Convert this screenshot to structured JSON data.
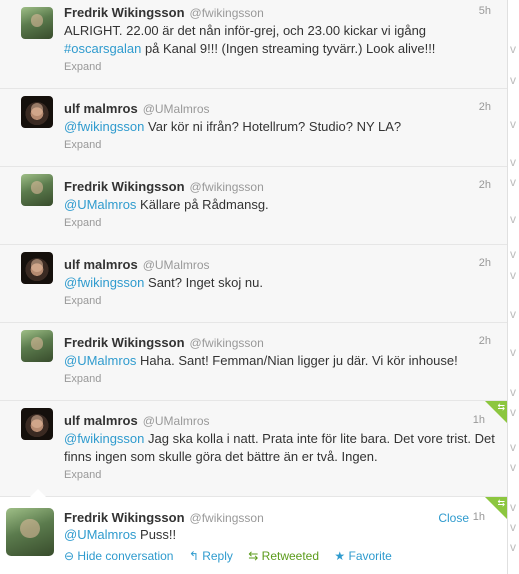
{
  "tweets": [
    {
      "name": "Fredrik Wikingsson",
      "handle": "@fwikingsson",
      "time": "5h",
      "text_parts": [
        {
          "t": "ALRIGHT. 22.00 är det nån inför-grej, och 23.00 kickar vi igång "
        },
        {
          "t": "#oscarsgalan",
          "link": true
        },
        {
          "t": " på Kanal 9!!! (Ingen streaming tyvärr.) Look alive!!!"
        }
      ],
      "expand": "Expand",
      "avatar": "fredrik-avatar"
    },
    {
      "name": "ulf malmros",
      "handle": "@UMalmros",
      "time": "2h",
      "text_parts": [
        {
          "t": "@fwikingsson",
          "link": true
        },
        {
          "t": " Var kör ni ifrån? Hotellrum? Studio? NY LA?"
        }
      ],
      "expand": "Expand",
      "avatar": "ulf-avatar"
    },
    {
      "name": "Fredrik Wikingsson",
      "handle": "@fwikingsson",
      "time": "2h",
      "text_parts": [
        {
          "t": "@UMalmros",
          "link": true
        },
        {
          "t": " Källare på Rådmansg."
        }
      ],
      "expand": "Expand",
      "avatar": "fredrik-avatar"
    },
    {
      "name": "ulf malmros",
      "handle": "@UMalmros",
      "time": "2h",
      "text_parts": [
        {
          "t": "@fwikingsson",
          "link": true
        },
        {
          "t": " Sant? Inget skoj nu."
        }
      ],
      "expand": "Expand",
      "avatar": "ulf-avatar"
    },
    {
      "name": "Fredrik Wikingsson",
      "handle": "@fwikingsson",
      "time": "2h",
      "text_parts": [
        {
          "t": "@UMalmros",
          "link": true
        },
        {
          "t": " Haha. Sant! Femman/Nian ligger ju där. Vi kör inhouse!"
        }
      ],
      "expand": "Expand",
      "avatar": "fredrik-avatar"
    },
    {
      "name": "ulf malmros",
      "handle": "@UMalmros",
      "time": "1h",
      "text_parts": [
        {
          "t": "@fwikingsson",
          "link": true
        },
        {
          "t": " Jag ska kolla i natt. Prata inte för lite bara. Det vore trist. Det finns ingen som skulle göra det bättre än er två. Ingen."
        }
      ],
      "expand": "Expand",
      "avatar": "ulf-avatar",
      "retweeted_corner": true
    }
  ],
  "expanded_tweet": {
    "name": "Fredrik Wikingsson",
    "handle": "@fwikingsson",
    "time": "1h",
    "close_label": "Close",
    "text_parts": [
      {
        "t": "@UMalmros",
        "link": true
      },
      {
        "t": " Puss!!"
      }
    ],
    "actions": {
      "hide": "Hide conversation",
      "reply": "Reply",
      "retweeted": "Retweeted",
      "favorite": "Favorite"
    },
    "icons": {
      "hide": "minus-circle-icon",
      "reply": "reply-arrow-icon",
      "retweeted": "retweet-icon",
      "favorite": "star-icon"
    },
    "retweeted_corner": true
  },
  "colors": {
    "link": "#2f9bce",
    "retweet_green": "#8cc63f"
  },
  "right_column_glyphs": [
    "v",
    "v",
    "v",
    "v",
    "v",
    "v",
    "v",
    "v",
    "v",
    "v",
    "v",
    "v",
    "v",
    "v",
    "v",
    "v",
    "v"
  ]
}
